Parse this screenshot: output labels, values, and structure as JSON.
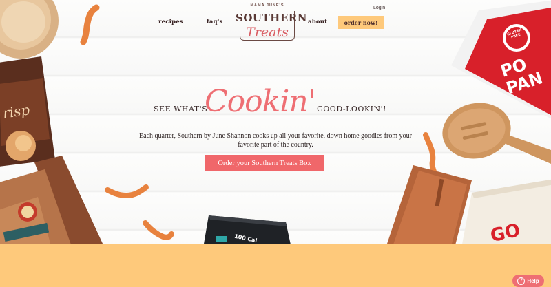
{
  "header": {
    "login_label": "Login",
    "nav": {
      "recipes": "recipes",
      "faqs": "faq's",
      "about": "about",
      "order": "order now!"
    },
    "logo": {
      "top": "MAMA JUNE'S",
      "main": "SOUTHERN",
      "sub": "Treats"
    }
  },
  "hero": {
    "tagline_left": "SEE WHAT'S",
    "tagline_script": "Cookin'",
    "tagline_right": "GOOD-LOOKIN'!",
    "description": "Each quarter, Southern by June Shannon cooks up all your favorite, down home goodies from your favorite part of the country.",
    "cta_label": "Order your Southern Treats Box"
  },
  "products": {
    "gluten_free_badge": "GLUTEN FREE",
    "popcorn_bag_text": "PO PAN",
    "chips_bag_text": "risp",
    "calorie_bag_text": "100 Cal",
    "towel_text": "GO"
  },
  "help_widget": {
    "label": "Help",
    "icon": "question-circle-icon"
  },
  "colors": {
    "accent_coral": "#f0676a",
    "accent_peach": "#fec97b",
    "text_dark": "#3a2424"
  }
}
